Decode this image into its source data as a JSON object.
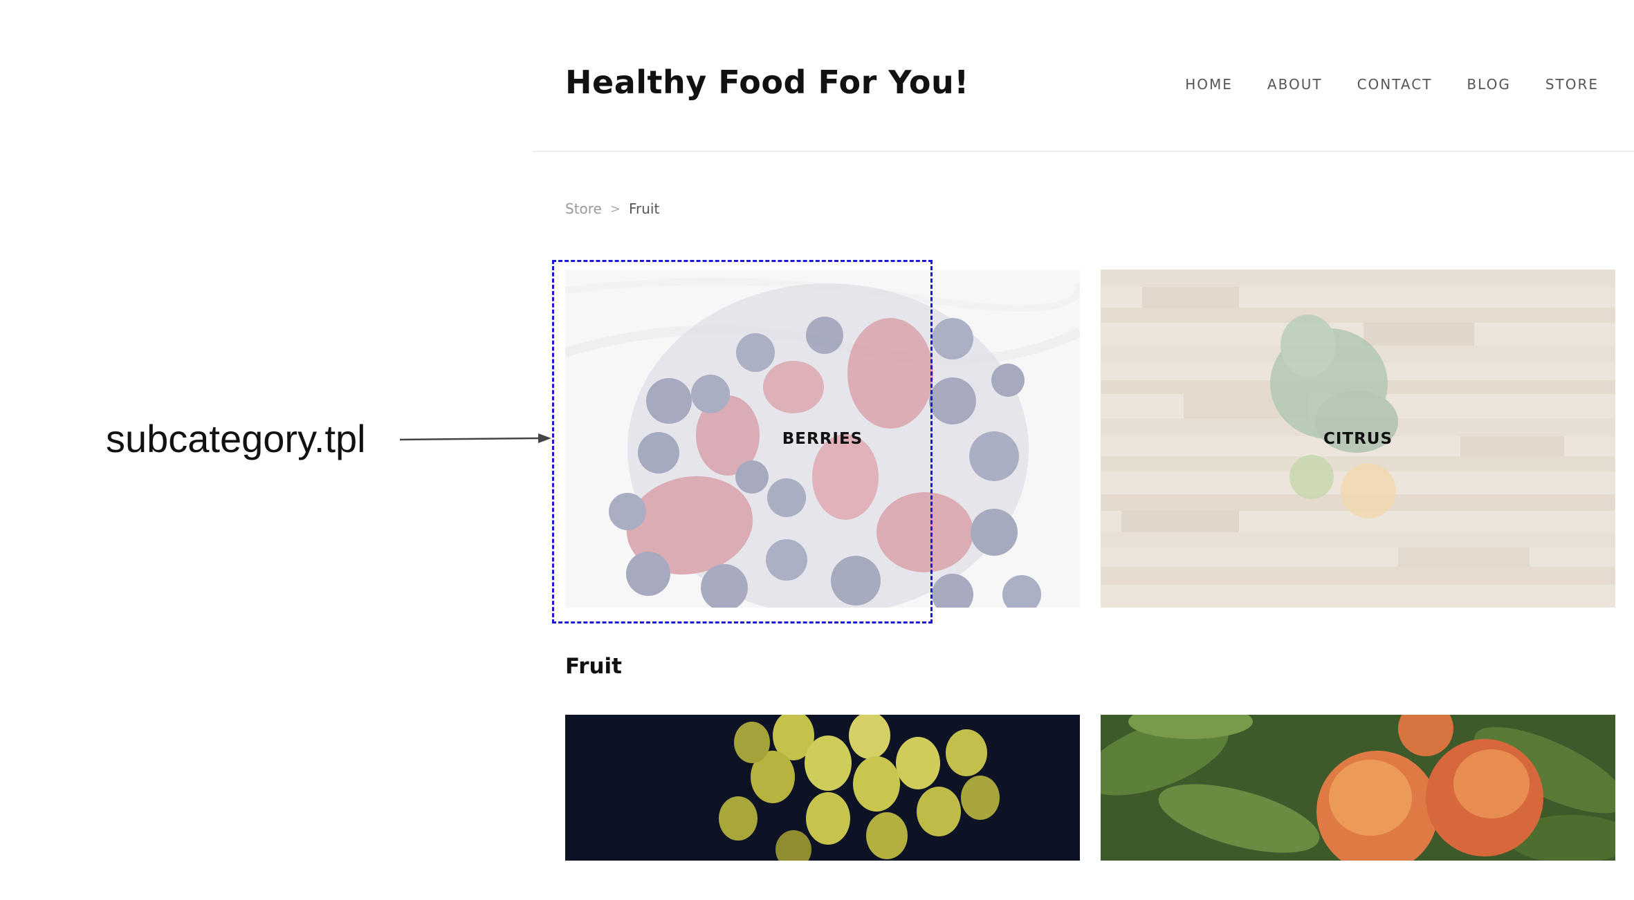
{
  "annotation": {
    "label": "subcategory.tpl",
    "arrow_color": "#444444",
    "box_color": "#1a1ad6"
  },
  "header": {
    "site_title": "Healthy Food For You!",
    "nav": [
      {
        "label": "HOME"
      },
      {
        "label": "ABOUT"
      },
      {
        "label": "CONTACT"
      },
      {
        "label": "BLOG"
      },
      {
        "label": "STORE"
      }
    ]
  },
  "breadcrumb": {
    "parent": "Store",
    "separator": ">",
    "current": "Fruit"
  },
  "subcategories": [
    {
      "label": "BERRIES",
      "image": "berries-photo"
    },
    {
      "label": "CITRUS",
      "image": "citrus-photo"
    }
  ],
  "section": {
    "heading": "Fruit"
  },
  "products": [
    {
      "image": "grapes-photo"
    },
    {
      "image": "peaches-photo"
    }
  ]
}
